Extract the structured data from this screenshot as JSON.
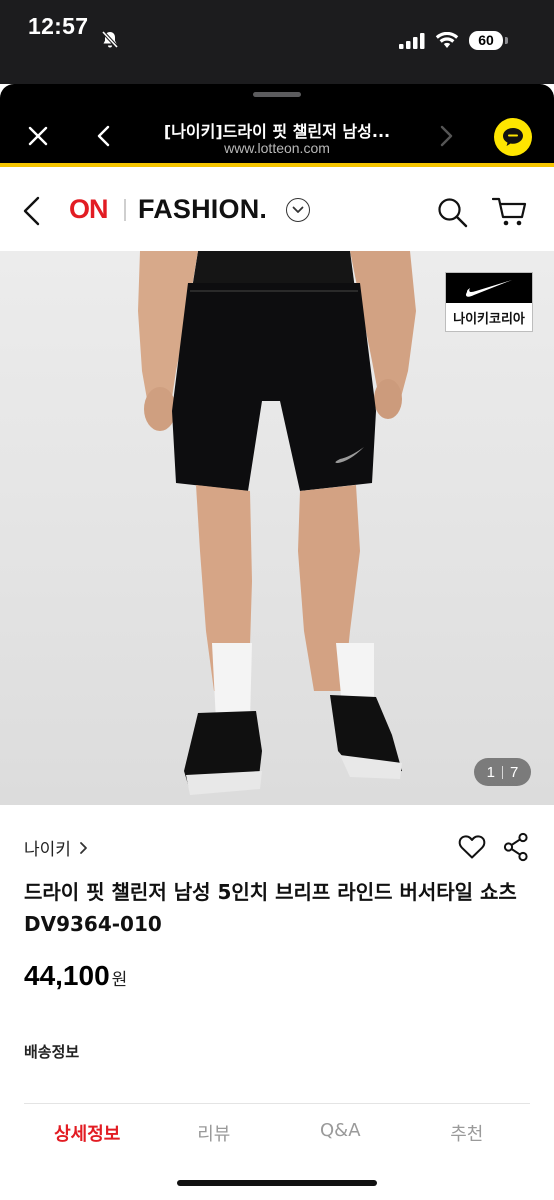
{
  "status_bar": {
    "time": "12:57",
    "battery": "60",
    "icons": [
      "bell-slash-icon",
      "cellular-signal-icon",
      "wifi-icon",
      "battery-icon"
    ]
  },
  "browser_sheet": {
    "title": "[나이키]드라이 핏 챌린저 남성...",
    "url": "www.lotteon.com",
    "accent_color": "#f5c400",
    "chat_color": "#fee500"
  },
  "site_header": {
    "logo_on": "ON",
    "logo_fashion": "FASHION.",
    "brand_color": "#e21c23"
  },
  "product": {
    "image_badge_text": "나이키코리아",
    "image_page_current": "1",
    "image_page_total": "7",
    "brand": "나이키",
    "title": "드라이 핏 챌린저 남성 5인치 브리프 라인드 버서타일 쇼츠 DV9364-010",
    "price": "44,100",
    "price_unit": "원",
    "shipping_label": "배송정보"
  },
  "tabs": [
    {
      "label": "상세정보",
      "active": true
    },
    {
      "label": "리뷰",
      "active": false
    },
    {
      "label": "Q&A",
      "active": false
    },
    {
      "label": "추천",
      "active": false
    }
  ]
}
